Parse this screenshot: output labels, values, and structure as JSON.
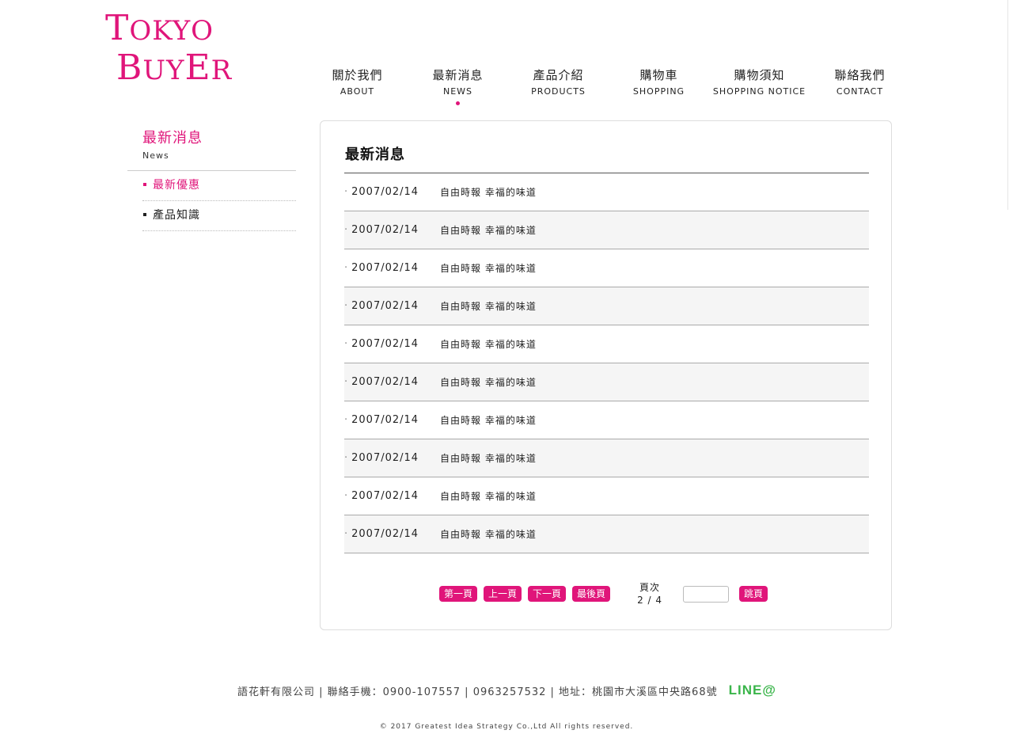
{
  "logo": {
    "line1_big": "T",
    "line1_rest": "OKYO",
    "line2_b": "B",
    "line2_u": "UY",
    "line2_e": "E",
    "line2_r": "R"
  },
  "nav": [
    {
      "zh": "關於我們",
      "en": "ABOUT"
    },
    {
      "zh": "最新消息",
      "en": "NEWS"
    },
    {
      "zh": "產品介紹",
      "en": "PRODUCTS"
    },
    {
      "zh": "購物車",
      "en": "SHOPPING"
    },
    {
      "zh": "購物須知",
      "en": "SHOPPING NOTICE"
    },
    {
      "zh": "聯絡我們",
      "en": "CONTACT"
    }
  ],
  "sidebar": {
    "title": "最新消息",
    "subtitle": "News",
    "items": [
      {
        "label": "最新優惠"
      },
      {
        "label": "產品知識"
      }
    ]
  },
  "main": {
    "title": "最新消息",
    "rows": [
      {
        "date": "2007/02/14",
        "title": "自由時報 幸福的味道"
      },
      {
        "date": "2007/02/14",
        "title": "自由時報 幸福的味道"
      },
      {
        "date": "2007/02/14",
        "title": "自由時報 幸福的味道"
      },
      {
        "date": "2007/02/14",
        "title": "自由時報 幸福的味道"
      },
      {
        "date": "2007/02/14",
        "title": "自由時報 幸福的味道"
      },
      {
        "date": "2007/02/14",
        "title": "自由時報 幸福的味道"
      },
      {
        "date": "2007/02/14",
        "title": "自由時報 幸福的味道"
      },
      {
        "date": "2007/02/14",
        "title": "自由時報 幸福的味道"
      },
      {
        "date": "2007/02/14",
        "title": "自由時報 幸福的味道"
      },
      {
        "date": "2007/02/14",
        "title": "自由時報 幸福的味道"
      }
    ]
  },
  "pager": {
    "first": "第一頁",
    "prev": "上一頁",
    "next": "下一頁",
    "last": "最後頁",
    "page_label": "頁次",
    "page_info": "2 / 4",
    "jump": "跳頁",
    "input_value": ""
  },
  "footer": {
    "info": "語花軒有限公司 | 聯絡手機：0900-107557 | 0963257532 | 地址：桃園市大溪區中央路68號",
    "line_label": "LINE@",
    "copyright": "© 2017 Greatest Idea Strategy Co.,Ltd All rights reserved."
  },
  "colors": {
    "accent": "#e0157a",
    "line_green": "#3ab54a"
  }
}
